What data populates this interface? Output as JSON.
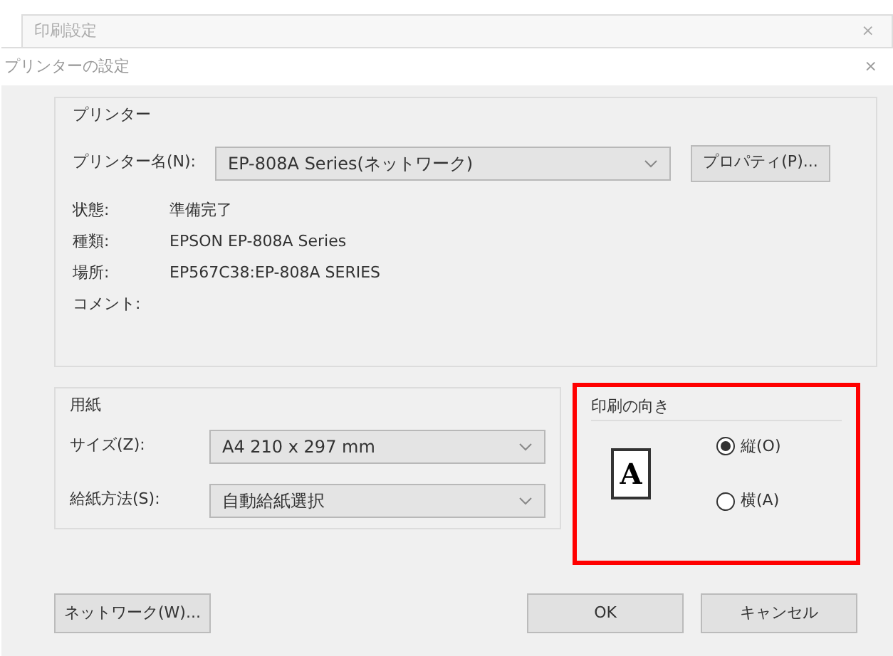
{
  "background_window": {
    "title": "印刷設定",
    "close": "×"
  },
  "window": {
    "title": "プリンターの設定",
    "close": "×"
  },
  "printer": {
    "group_title": "プリンター",
    "name_label": "プリンター名(N):",
    "name_value": "EP-808A Series(ネットワーク)",
    "properties_button": "プロパティ(P)...",
    "info": [
      {
        "label": "状態:",
        "value": "準備完了"
      },
      {
        "label": "種類:",
        "value": "EPSON EP-808A Series"
      },
      {
        "label": "場所:",
        "value": "EP567C38:EP-808A SERIES"
      },
      {
        "label": "コメント:"
      }
    ]
  },
  "paper": {
    "group_title": "用紙",
    "fields": [
      {
        "label": "サイズ(Z):",
        "value": "A4 210 x 297 mm"
      },
      {
        "label": "給紙方法(S):",
        "value": "自動給紙選択"
      }
    ]
  },
  "orientation": {
    "group_title": "印刷の向き",
    "highlighted": true,
    "preview_letter": "A",
    "options": [
      {
        "label": "縦(O)",
        "selected": true
      },
      {
        "label": "横(A)",
        "selected": false
      }
    ]
  },
  "buttons": {
    "network": "ネットワーク(W)...",
    "ok": "OK",
    "cancel": "キャンセル"
  }
}
